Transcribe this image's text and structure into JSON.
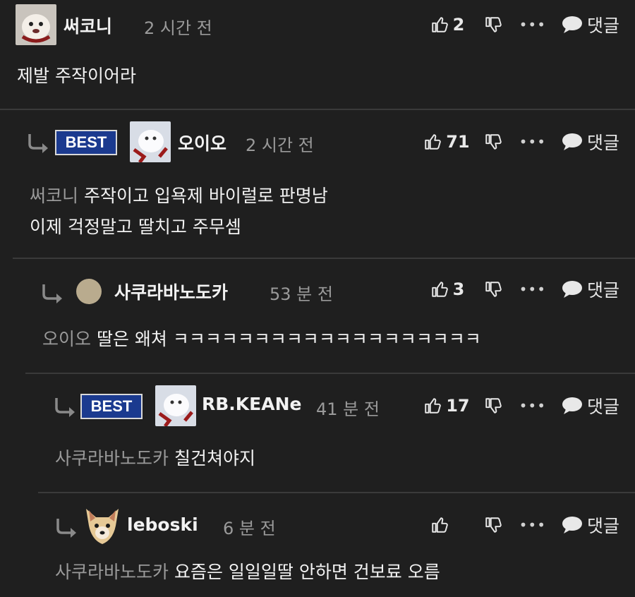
{
  "reply_label": "댓글",
  "more_label": "•••",
  "best_label": "BEST",
  "comments": [
    {
      "user": "써코니",
      "time": "2 시간 전",
      "likes": "2",
      "mention": "",
      "lines": [
        "제발 주작이어라"
      ]
    },
    {
      "user": "오이오",
      "time": "2 시간 전",
      "likes": "71",
      "mention": "써코니",
      "lines": [
        "주작이고 입욕제 바이럴로 판명남",
        "이제 걱정말고 딸치고 주무셈"
      ]
    },
    {
      "user": "사쿠라바노도카",
      "time": "53 분 전",
      "likes": "3",
      "mention": "오이오",
      "lines": [
        "딸은 왜쳐 ㅋㅋㅋㅋㅋㅋㅋㅋㅋㅋㅋㅋㅋㅋㅋㅋㅋㅋㅋ"
      ]
    },
    {
      "user": "RB.KEANe",
      "time": "41 분 전",
      "likes": "17",
      "mention": "사쿠라바노도카",
      "lines": [
        "칠건쳐야지"
      ]
    },
    {
      "user": "leboski",
      "time": "6 분 전",
      "likes": "",
      "mention": "사쿠라바노도카",
      "lines": [
        "요즘은 일일일딸 안하면 건보료 오름"
      ]
    }
  ]
}
